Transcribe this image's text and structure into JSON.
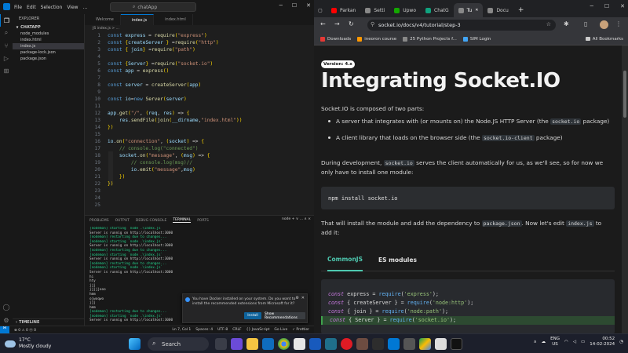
{
  "vscode": {
    "title_search": "chatApp",
    "menu": [
      "File",
      "Edit",
      "Selection",
      "View",
      "…"
    ],
    "explorer": {
      "header": "EXPLORER",
      "section": "CHATAPP",
      "files": [
        {
          "name": "node_modules",
          "selected": false
        },
        {
          "name": "index.html",
          "selected": false
        },
        {
          "name": "index.js",
          "selected": true
        },
        {
          "name": "package-lock.json",
          "selected": false
        },
        {
          "name": "package.json",
          "selected": false
        }
      ],
      "timeline": "TIMELINE"
    },
    "tabs": [
      {
        "label": "Welcome",
        "active": false
      },
      {
        "label": "index.js",
        "active": true
      },
      {
        "label": "index.html",
        "active": false
      }
    ],
    "breadcrumb": "JS index.js > ...",
    "code_lines": [
      {
        "n": "1",
        "t": "const express = require(\"express\")"
      },
      {
        "n": "2",
        "t": "const {createServer } =require(\"http\")"
      },
      {
        "n": "3",
        "t": "const { join} =require(\"path\")"
      },
      {
        "n": "4",
        "t": ""
      },
      {
        "n": "5",
        "t": "const {Server} =require(\"socket.io\")"
      },
      {
        "n": "6",
        "t": "const app = express()"
      },
      {
        "n": "7",
        "t": ""
      },
      {
        "n": "8",
        "t": "const server = createServer(app)"
      },
      {
        "n": "9",
        "t": ""
      },
      {
        "n": "10",
        "t": "const io=new Server(server)"
      },
      {
        "n": "11",
        "t": ""
      },
      {
        "n": "12",
        "t": "app.get(\"/\", (req, res) => {"
      },
      {
        "n": "13",
        "t": "    res.sendFile(join(__dirname,\"index.html\"))"
      },
      {
        "n": "14",
        "t": "})"
      },
      {
        "n": "15",
        "t": ""
      },
      {
        "n": "16",
        "t": "io.on(\"connection\", (socket) => {"
      },
      {
        "n": "17",
        "t": "    // console.log(\"connected\")"
      },
      {
        "n": "18",
        "t": "    socket.on(\"message\", (msg) => {"
      },
      {
        "n": "19",
        "t": "        // console.log(msg)//"
      },
      {
        "n": "20",
        "t": "        io.emit(\"message\",msg)"
      },
      {
        "n": "21",
        "t": "    })"
      },
      {
        "n": "22",
        "t": "})"
      },
      {
        "n": "23",
        "t": ""
      },
      {
        "n": "24",
        "t": ""
      },
      {
        "n": "25",
        "t": ""
      }
    ],
    "panel_tabs": [
      {
        "label": "PROBLEMS",
        "active": false
      },
      {
        "label": "OUTPUT",
        "active": false
      },
      {
        "label": "DEBUG CONSOLE",
        "active": false
      },
      {
        "label": "TERMINAL",
        "active": true
      },
      {
        "label": "PORTS",
        "active": false
      }
    ],
    "panel_right": "node  +  ∨  …  ∧  ×",
    "terminal_lines": [
      "[nodemon] starting `node .\\index.js`",
      "Server is runnig on http://localhost:3000",
      "[nodemon] restarting due to changes...",
      "[nodemon] starting `node .\\index.js`",
      "Server is runnig on http://localhost:3000",
      "[nodemon] restarting due to changes...",
      "[nodemon] starting `node .\\index.js`",
      "Server is runnig on http://localhost:3000",
      "[nodemon] restarting due to changes...",
      "[nodemon] starting `node .\\index.js`",
      "Server is runnig on http://localhost:3000",
      "hi",
      "hty",
      "jjj",
      "jjjjjooo",
      "hmm",
      "ojwoqwo",
      "jjj",
      "hmm",
      "[nodemon] restarting due to changes...",
      "[nodemon] starting `node .\\index.js`",
      "Server is runnig on http://localhost:3000"
    ],
    "notification": {
      "text": "You have Docker installed on your system. Do you want to install the recommended extensions from Microsoft for it?",
      "install": "Install",
      "show": "Show Recommendations"
    },
    "status_left": "⊗ 0 ⚠ 0  ⓦ 0",
    "status_right": [
      "Ln 7, Col 1",
      "Spaces: 4",
      "UTF-8",
      "CRLF",
      "{} JavaScript",
      "Go Live",
      "✓ Prettier"
    ]
  },
  "chrome": {
    "tabs": [
      {
        "label": "Parkan",
        "active": false,
        "color": "#ff0000"
      },
      {
        "label": "Setti",
        "active": false,
        "color": "#888888"
      },
      {
        "label": "Upwo",
        "active": false,
        "color": "#14a800"
      },
      {
        "label": "ChatG",
        "active": false,
        "color": "#10a37f"
      },
      {
        "label": "Tu",
        "active": true,
        "color": "#888888"
      },
      {
        "label": "Docu",
        "active": false,
        "color": "#888888"
      }
    ],
    "new_tab": "+",
    "url": "socket.io/docs/v4/tutorial/step-3",
    "bookmarks": [
      {
        "label": "Downloads",
        "color": "#e53935"
      },
      {
        "label": "ineoron course",
        "color": "#ff9800"
      },
      {
        "label": "25 Python Projects f...",
        "color": "#888888"
      },
      {
        "label": "SIM Login",
        "color": "#42a5f5"
      }
    ],
    "all_bookmarks": "All Bookmarks",
    "page": {
      "version": "Version: 4.x",
      "title": "Integrating Socket.IO",
      "intro": "Socket.IO is composed of two parts:",
      "bullet1_a": "A server that integrates with (or mounts on) the Node.JS HTTP Server (the ",
      "bullet1_code": "socket.io",
      "bullet1_b": " package)",
      "bullet2_a": "A client library that loads on the browser side (the ",
      "bullet2_code": "socket.io-client",
      "bullet2_b": " package)",
      "dev_a": "During development, ",
      "dev_code": "socket.io",
      "dev_b": " serves the client automatically for us, as we'll see, so for now we only have to install one module:",
      "install_cmd": "npm install socket.io",
      "after_a": "That will install the module and add the dependency to ",
      "after_code1": "package.json",
      "after_b": ". Now let's edit ",
      "after_code2": "index.js",
      "after_c": " to add it:",
      "module_tabs": [
        {
          "label": "CommonJS",
          "active": true
        },
        {
          "label": "ES modules",
          "active": false
        }
      ],
      "code": [
        {
          "kw": "const",
          "mid": " express = ",
          "fn": "require",
          "str": "'express'",
          "end": ");",
          "hl": false
        },
        {
          "kw": "const",
          "mid": " { createServer } = ",
          "fn": "require",
          "str": "'node:http'",
          "end": ");",
          "hl": false
        },
        {
          "kw": "const",
          "mid": " { join } = ",
          "fn": "require",
          "str": "'node:path'",
          "end": ");",
          "hl": false
        },
        {
          "kw": "const",
          "mid": " { Server } = ",
          "fn": "require",
          "str": "'socket.io'",
          "end": ");",
          "hl": true
        }
      ]
    }
  },
  "taskbar": {
    "weather_temp": "17°C",
    "weather_desc": "Mostly cloudy",
    "search_label": "Search",
    "lang": "ENG",
    "lang2": "US",
    "time": "00:52",
    "date": "14-02-2024"
  }
}
